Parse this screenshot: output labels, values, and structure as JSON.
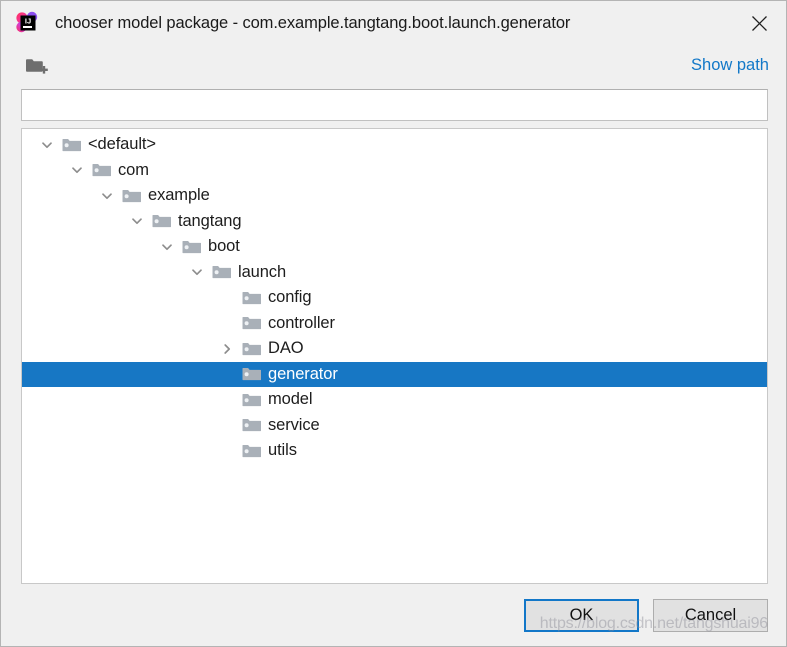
{
  "window": {
    "title": "chooser model package - com.example.tangtang.boot.launch.generator",
    "app_icon": "intellij-idea-icon",
    "close_icon": "close-icon"
  },
  "toolbar": {
    "new_folder_icon": "new-folder-icon",
    "show_path_label": "Show path",
    "accent_color": "#1278c8"
  },
  "path_input": {
    "value": "",
    "placeholder": ""
  },
  "tree": {
    "selection_color": "#1777c4",
    "folder_icon": "folder-icon",
    "expanded_icon": "chevron-down-icon",
    "collapsed_icon": "chevron-right-icon",
    "rows": [
      {
        "label": "<default>",
        "depth": 0,
        "twisty": "expanded",
        "selected": false
      },
      {
        "label": "com",
        "depth": 1,
        "twisty": "expanded",
        "selected": false
      },
      {
        "label": "example",
        "depth": 2,
        "twisty": "expanded",
        "selected": false
      },
      {
        "label": "tangtang",
        "depth": 3,
        "twisty": "expanded",
        "selected": false
      },
      {
        "label": "boot",
        "depth": 4,
        "twisty": "expanded",
        "selected": false
      },
      {
        "label": "launch",
        "depth": 5,
        "twisty": "expanded",
        "selected": false
      },
      {
        "label": "config",
        "depth": 6,
        "twisty": "none",
        "selected": false
      },
      {
        "label": "controller",
        "depth": 6,
        "twisty": "none",
        "selected": false
      },
      {
        "label": "DAO",
        "depth": 6,
        "twisty": "collapsed",
        "selected": false
      },
      {
        "label": "generator",
        "depth": 6,
        "twisty": "none",
        "selected": true
      },
      {
        "label": "model",
        "depth": 6,
        "twisty": "none",
        "selected": false
      },
      {
        "label": "service",
        "depth": 6,
        "twisty": "none",
        "selected": false
      },
      {
        "label": "utils",
        "depth": 6,
        "twisty": "none",
        "selected": false
      }
    ]
  },
  "buttons": {
    "ok_label": "OK",
    "cancel_label": "Cancel"
  },
  "watermark": {
    "text": "https://blog.csdn.net/tangshuai96"
  }
}
